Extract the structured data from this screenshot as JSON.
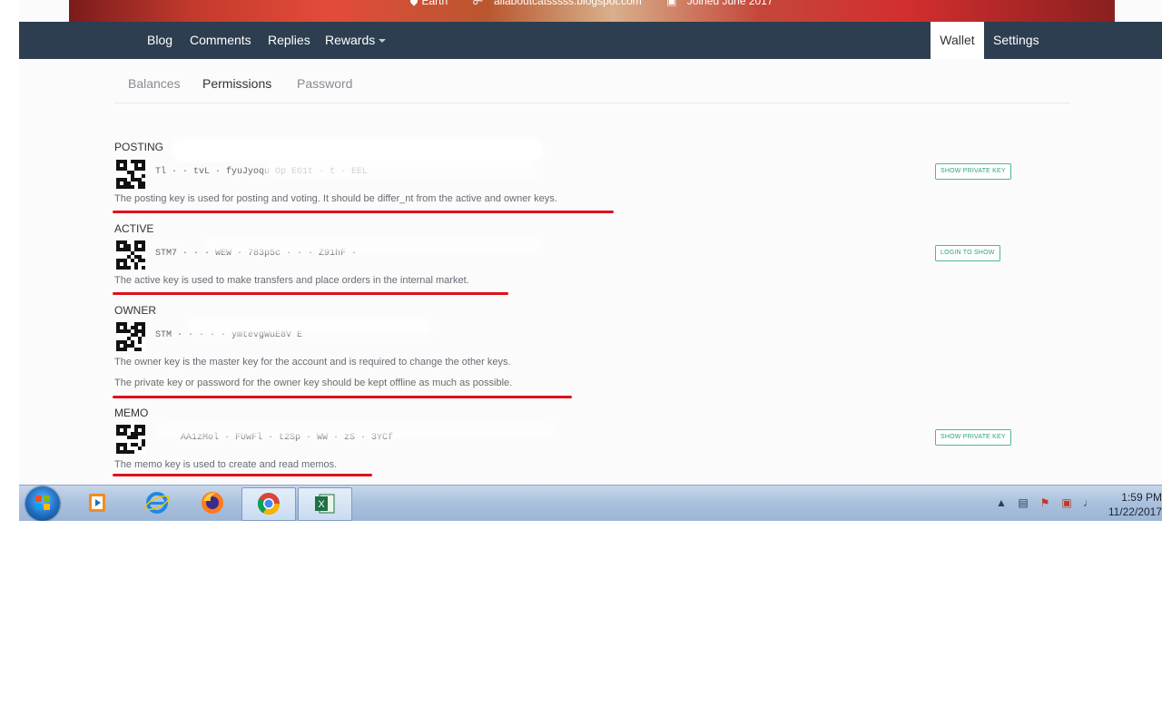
{
  "cover": {
    "location": "Earth",
    "website": "allaboutcatsssss.blogspot.com",
    "joined": "Joined June 2017"
  },
  "nav": {
    "blog": "Blog",
    "comments": "Comments",
    "replies": "Replies",
    "rewards": "Rewards",
    "wallet": "Wallet",
    "settings": "Settings"
  },
  "tabs": {
    "balances": "Balances",
    "permissions": "Permissions",
    "password": "Password"
  },
  "sections": {
    "posting": {
      "title": "POSTING",
      "key_fragment": "Tl  · · tvL  · fyuJyoqu Op  EG1t   ·  t   ·  EEL",
      "desc": "The posting key is used for posting and voting. It should be differ_nt from the active and owner keys.",
      "button": "SHOW PRIVATE KEY"
    },
    "active": {
      "title": "ACTIVE",
      "key_fragment": "STM7  ·  · · WEW   · 783p5c   ·  ·  · Z91hF ·",
      "desc": "The active key is used to make transfers and place orders in the internal market.",
      "button": "LOGIN TO SHOW"
    },
    "owner": {
      "title": "OWNER",
      "key_fragment": "STM  ·  ·  ·  ·  · ymtevgWuE8V  E",
      "desc1": "The owner key is the master key for the account and is required to change the other keys.",
      "desc2": "The private key or password for the owner key should be kept offline as much as possible."
    },
    "memo": {
      "title": "MEMO",
      "key_fragment": "AA1zMol  · FUwFl  · t2Sp  · WW  · zS  · 3YCf",
      "desc": "The memo key is used to create and read memos.",
      "button": "SHOW PRIVATE KEY"
    }
  },
  "taskbar": {
    "time": "1:59 PM",
    "date": "11/22/2017"
  },
  "colors": {
    "nav_bg": "#2c3e50",
    "button_green": "#52b889",
    "annotation_red": "#e0101c",
    "taskbar": "#a9c0dc"
  }
}
